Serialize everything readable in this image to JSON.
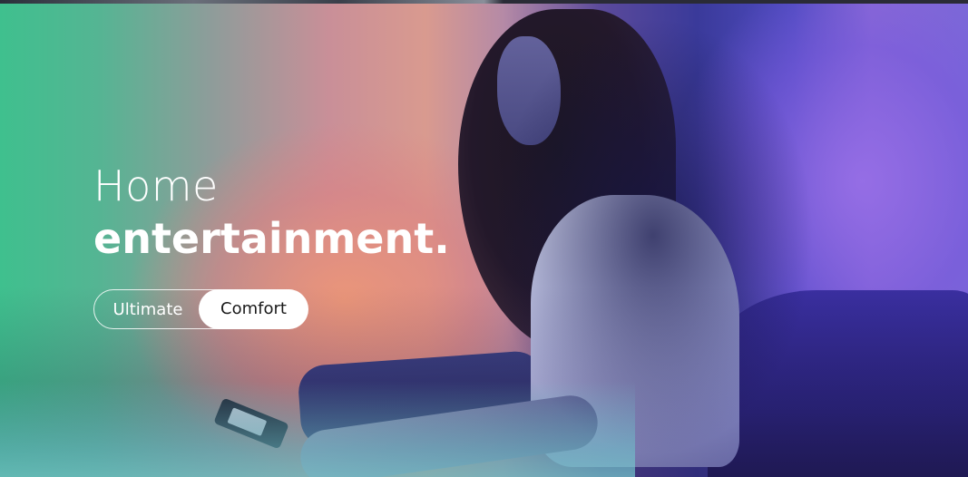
{
  "hero": {
    "title_line1": "Home",
    "title_line2": "entertainment."
  },
  "toggle": {
    "options": [
      {
        "label": "Ultimate",
        "selected": false
      },
      {
        "label": "Comfort",
        "selected": true
      }
    ]
  },
  "colors": {
    "accent_green": "#3fc08e",
    "accent_purple": "#7b68d8",
    "text": "#ffffff",
    "toggle_selected_bg": "#ffffff",
    "toggle_selected_text": "#1a1a1a"
  }
}
